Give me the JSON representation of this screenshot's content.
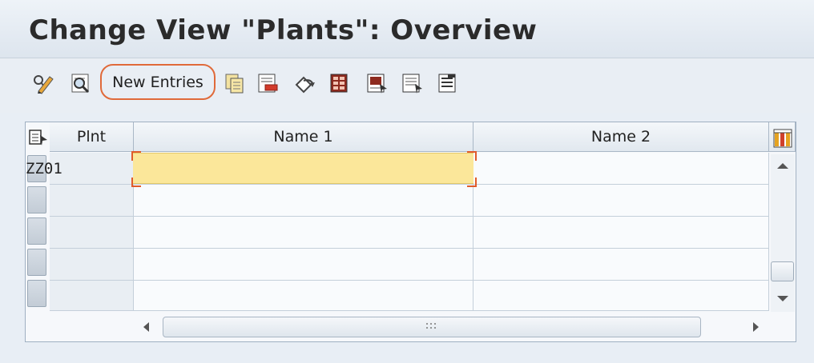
{
  "window": {
    "title": "Change View \"Plants\": Overview"
  },
  "toolbar": {
    "new_entries_label": "New Entries",
    "icons": [
      "display-change-icon",
      "details-icon",
      "copy-as-icon",
      "delete-icon",
      "undo-change-icon",
      "select-all-icon",
      "select-block-icon",
      "deselect-all-icon",
      "print-icon"
    ]
  },
  "table": {
    "columns": [
      "Plnt",
      "Name 1",
      "Name 2"
    ],
    "rows": [
      {
        "plnt": "ZZ01",
        "name1": "",
        "name2": ""
      },
      {
        "plnt": "",
        "name1": "",
        "name2": ""
      },
      {
        "plnt": "",
        "name1": "",
        "name2": ""
      },
      {
        "plnt": "",
        "name1": "",
        "name2": ""
      },
      {
        "plnt": "",
        "name1": "",
        "name2": ""
      }
    ]
  },
  "colors": {
    "highlight": "#e06a3a",
    "active_cell": "#fbe79a",
    "corner_marker": "#e05b2b"
  }
}
